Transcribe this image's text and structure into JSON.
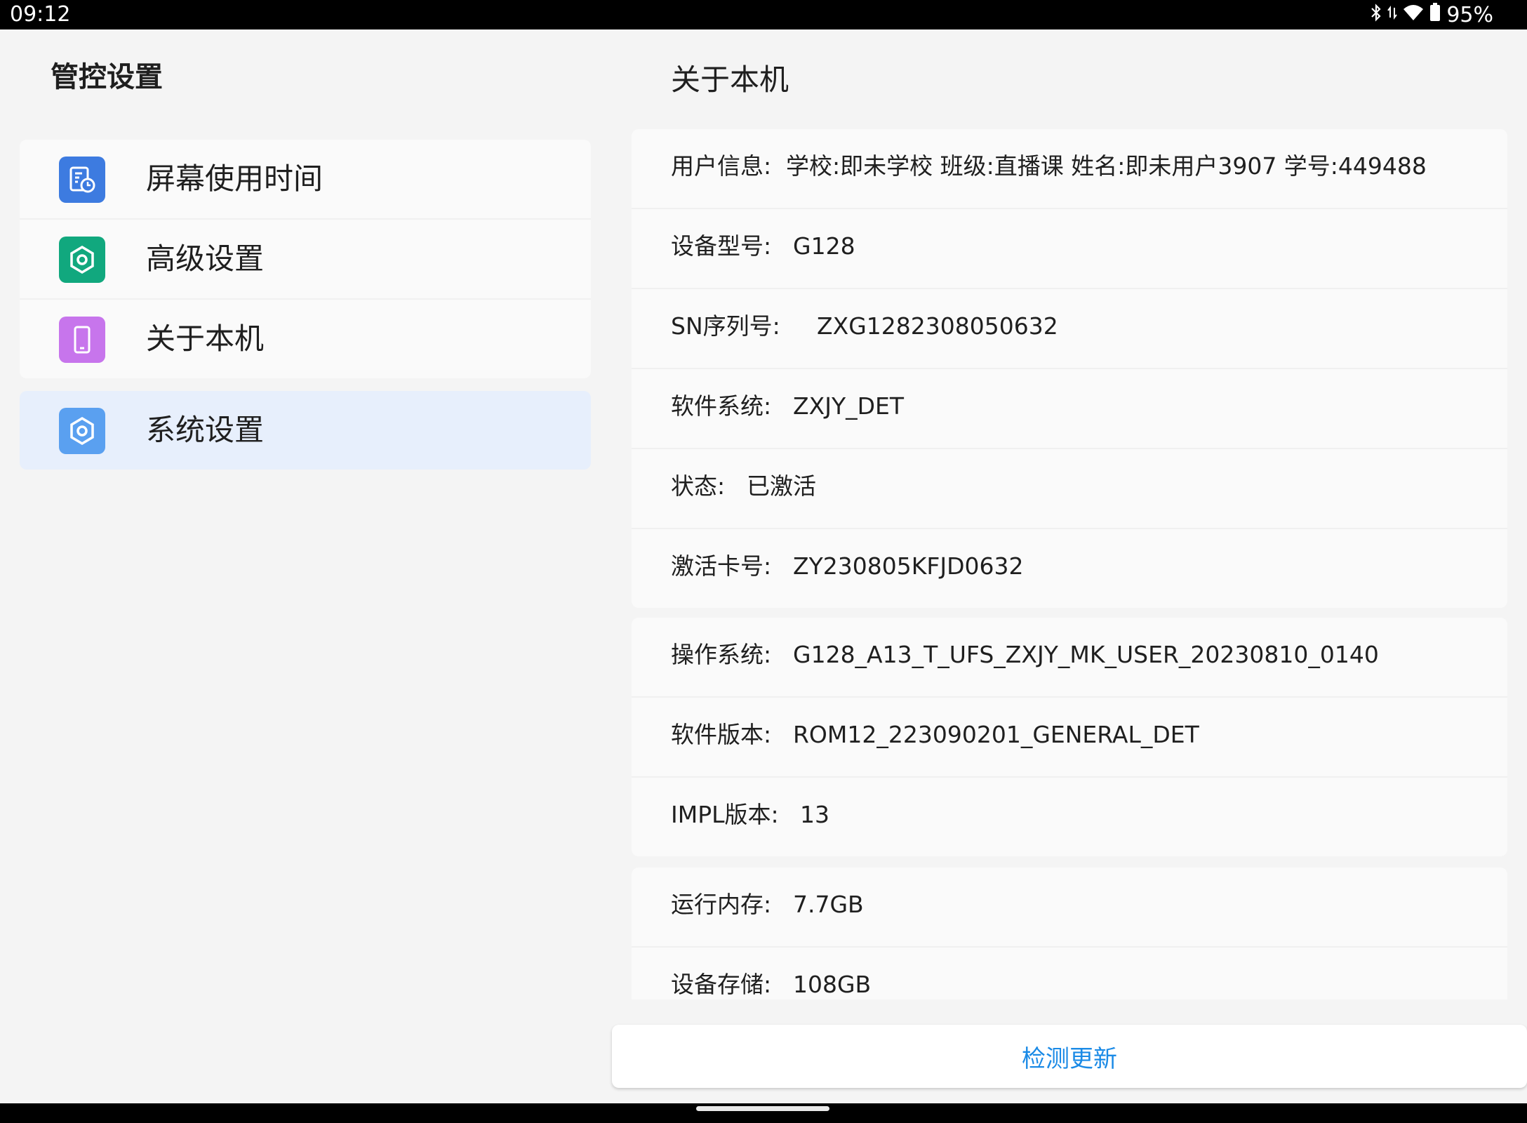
{
  "status_bar": {
    "time": "09:12",
    "battery": "95%",
    "icons": [
      "bluetooth-icon",
      "data-arrows-icon",
      "wifi-icon",
      "battery-icon"
    ]
  },
  "left_pane": {
    "title": "管控设置",
    "menu": [
      {
        "label": "屏幕使用时间",
        "icon": "screen-time-icon",
        "color": "#3d7be0"
      },
      {
        "label": "高级设置",
        "icon": "advanced-settings-icon",
        "color": "#11a87e"
      },
      {
        "label": "关于本机",
        "icon": "phone-icon",
        "color": "#c775ec"
      }
    ],
    "system_settings": {
      "label": "系统设置",
      "icon": "gear-icon",
      "color": "#5aa0f0",
      "selected": true
    }
  },
  "right_pane": {
    "title": "关于本机",
    "groups": [
      [
        {
          "label": "用户信息:",
          "value": "学校:即未学校 班级:直播课 姓名:即未用户3907 学号:449488"
        },
        {
          "label": "设备型号:",
          "value": "G128"
        },
        {
          "label": "SN序列号:",
          "value": "ZXG1282308050632"
        },
        {
          "label": "软件系统:",
          "value": "ZXJY_DET"
        },
        {
          "label": "状态:",
          "value": "已激活"
        },
        {
          "label": "激活卡号:",
          "value": "ZY230805KFJD0632"
        }
      ],
      [
        {
          "label": "操作系统:",
          "value": "G128_A13_T_UFS_ZXJY_MK_USER_20230810_0140"
        },
        {
          "label": "软件版本:",
          "value": "ROM12_223090201_GENERAL_DET"
        },
        {
          "label": "IMPL版本:",
          "value": "13"
        }
      ],
      [
        {
          "label": "运行内存:",
          "value": "7.7GB"
        },
        {
          "label": "设备存储:",
          "value": "108GB"
        }
      ]
    ],
    "update_button": "检测更新"
  },
  "colors": {
    "accent": "#1a8ae6",
    "selected_bg": "#e7effc",
    "page_bg": "#f4f4f4"
  }
}
